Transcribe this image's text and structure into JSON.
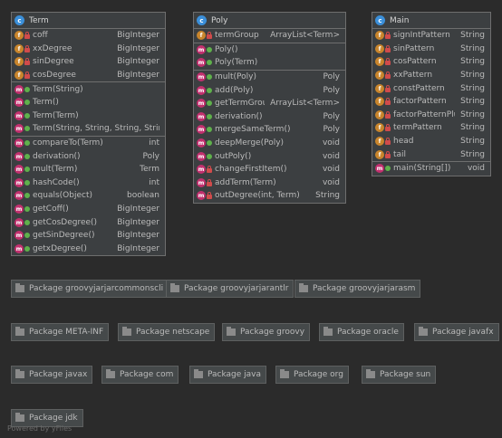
{
  "classes": [
    {
      "name": "Term",
      "icon": "class-icon",
      "fields": [
        {
          "name": "coff",
          "type": "BigInteger",
          "visibility": "private"
        },
        {
          "name": "xxDegree",
          "type": "BigInteger",
          "visibility": "private"
        },
        {
          "name": "sinDegree",
          "type": "BigInteger",
          "visibility": "private"
        },
        {
          "name": "cosDegree",
          "type": "BigInteger",
          "visibility": "private"
        }
      ],
      "constructors": [
        {
          "name": "Term(String)",
          "type": "",
          "visibility": "public"
        },
        {
          "name": "Term()",
          "type": "",
          "visibility": "public"
        },
        {
          "name": "Term(Term)",
          "type": "",
          "visibility": "public"
        },
        {
          "name": "Term(String, String, String, String)",
          "type": "",
          "visibility": "public"
        }
      ],
      "methods": [
        {
          "name": "compareTo(Term)",
          "type": "int",
          "visibility": "public"
        },
        {
          "name": "derivation()",
          "type": "Poly",
          "visibility": "public"
        },
        {
          "name": "mult(Term)",
          "type": "Term",
          "visibility": "public"
        },
        {
          "name": "hashCode()",
          "type": "int",
          "visibility": "public"
        },
        {
          "name": "equals(Object)",
          "type": "boolean",
          "visibility": "public"
        },
        {
          "name": "getCoff()",
          "type": "BigInteger",
          "visibility": "public"
        },
        {
          "name": "getCosDegree()",
          "type": "BigInteger",
          "visibility": "public"
        },
        {
          "name": "getSinDegree()",
          "type": "BigInteger",
          "visibility": "public"
        },
        {
          "name": "getxDegree()",
          "type": "BigInteger",
          "visibility": "public"
        }
      ]
    },
    {
      "name": "Poly",
      "icon": "class-icon",
      "fields": [
        {
          "name": "termGroup",
          "type": "ArrayList<Term>",
          "visibility": "private"
        }
      ],
      "constructors": [
        {
          "name": "Poly()",
          "type": "",
          "visibility": "public"
        },
        {
          "name": "Poly(Term)",
          "type": "",
          "visibility": "public"
        }
      ],
      "methods": [
        {
          "name": "mult(Poly)",
          "type": "Poly",
          "visibility": "public"
        },
        {
          "name": "add(Poly)",
          "type": "Poly",
          "visibility": "public"
        },
        {
          "name": "getTermGroup()",
          "type": "ArrayList<Term>",
          "visibility": "public"
        },
        {
          "name": "derivation()",
          "type": "Poly",
          "visibility": "public"
        },
        {
          "name": "mergeSameTerm()",
          "type": "Poly",
          "visibility": "public"
        },
        {
          "name": "deepMerge(Poly)",
          "type": "void",
          "visibility": "public"
        },
        {
          "name": "outPoly()",
          "type": "void",
          "visibility": "public"
        },
        {
          "name": "changeFirstItem()",
          "type": "void",
          "visibility": "private"
        },
        {
          "name": "addTerm(Term)",
          "type": "void",
          "visibility": "private"
        },
        {
          "name": "outDegree(int, Term)",
          "type": "String",
          "visibility": "private"
        }
      ]
    },
    {
      "name": "Main",
      "icon": "class-icon",
      "fields": [
        {
          "name": "signIntPattern",
          "type": "String",
          "visibility": "private"
        },
        {
          "name": "sinPattern",
          "type": "String",
          "visibility": "private"
        },
        {
          "name": "cosPattern",
          "type": "String",
          "visibility": "private"
        },
        {
          "name": "xxPattern",
          "type": "String",
          "visibility": "private"
        },
        {
          "name": "constPattern",
          "type": "String",
          "visibility": "private"
        },
        {
          "name": "factorPattern",
          "type": "String",
          "visibility": "private"
        },
        {
          "name": "factorPatternPlus",
          "type": "String",
          "visibility": "private"
        },
        {
          "name": "termPattern",
          "type": "String",
          "visibility": "private"
        },
        {
          "name": "head",
          "type": "String",
          "visibility": "private"
        },
        {
          "name": "tail",
          "type": "String",
          "visibility": "private"
        }
      ],
      "constructors": [],
      "methods": [
        {
          "name": "main(String[])",
          "type": "void",
          "visibility": "public"
        }
      ]
    }
  ],
  "packages": [
    "Package groovyjarjarcommonscli",
    "Package groovyjarjarantlr",
    "Package groovyjarjarasm",
    "Package META-INF",
    "Package netscape",
    "Package groovy",
    "Package oracle",
    "Package javafx",
    "Package javax",
    "Package com",
    "Package java",
    "Package org",
    "Package sun",
    "Package jdk"
  ],
  "footer": {
    "credit": "Powered by yFiles"
  },
  "colors": {
    "background": "#2b2b2b",
    "class_icon": "#3b8fd9",
    "field_icon": "#c9852c",
    "method_icon": "#c2306e",
    "private": "#d14b4b",
    "public": "#5fb14b"
  }
}
